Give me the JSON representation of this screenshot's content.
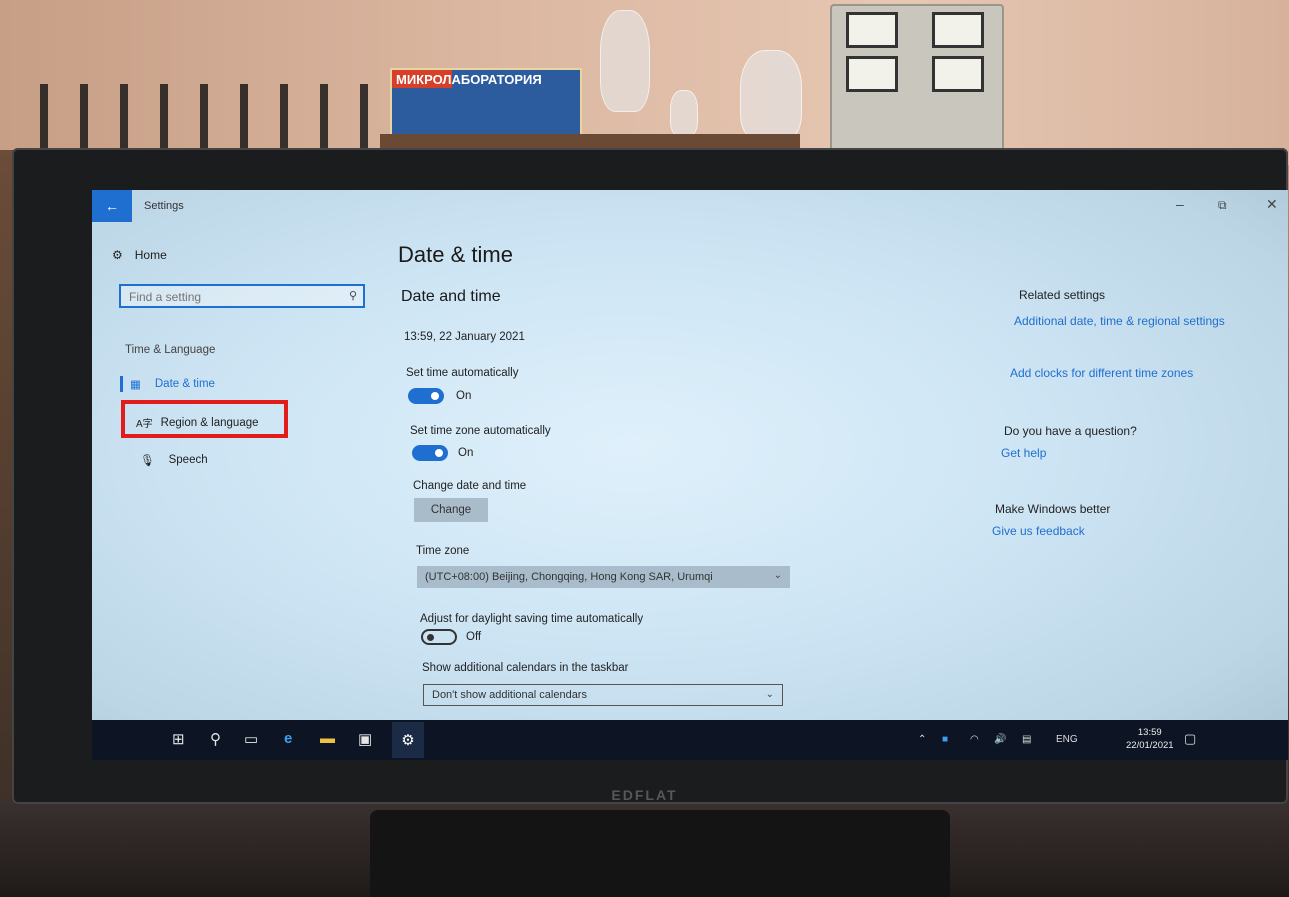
{
  "photo": {
    "shelf_sign": "МИКРОЛАБОРАТОРИЯ",
    "monitor_brand": "EDFLAT"
  },
  "window": {
    "title": "Settings",
    "back_icon": "back-arrow-icon",
    "controls": {
      "minimize": "–",
      "restore": "⧉",
      "close": "✕"
    }
  },
  "nav": {
    "home_label": "Home",
    "search_placeholder": "Find a setting",
    "section_label": "Time & Language",
    "items": [
      {
        "label": "Date & time",
        "icon": "date-time-icon",
        "active": true
      },
      {
        "label": "Region & language",
        "icon": "region-icon",
        "active": false
      },
      {
        "label": "Speech",
        "icon": "microphone-icon",
        "active": false
      }
    ],
    "highlight_color": "#e21b1b"
  },
  "main": {
    "page_title": "Date & time",
    "section_title": "Date and time",
    "current_datetime": "13:59, 22 January 2021",
    "set_time_auto": {
      "label": "Set time automatically",
      "state": "On"
    },
    "set_tz_auto": {
      "label": "Set time zone automatically",
      "state": "On"
    },
    "change_label": "Change date and time",
    "change_button": "Change",
    "timezone_label": "Time zone",
    "timezone_value": "(UTC+08:00) Beijing, Chongqing, Hong Kong SAR, Urumqi",
    "dst": {
      "label": "Adjust for daylight saving time automatically",
      "state": "Off"
    },
    "calendars_label": "Show additional calendars in the taskbar",
    "calendars_value": "Don't show additional calendars"
  },
  "related": {
    "heading": "Related settings",
    "link1": "Additional date, time & regional settings",
    "link2": "Add clocks for different time zones",
    "question_heading": "Do you have a question?",
    "help_link": "Get help",
    "better_heading": "Make Windows better",
    "feedback_link": "Give us feedback"
  },
  "taskbar": {
    "lang": "ENG",
    "time": "13:59",
    "date": "22/01/2021"
  },
  "colors": {
    "accent": "#1f6fd0",
    "taskbar": "#0d1424"
  }
}
